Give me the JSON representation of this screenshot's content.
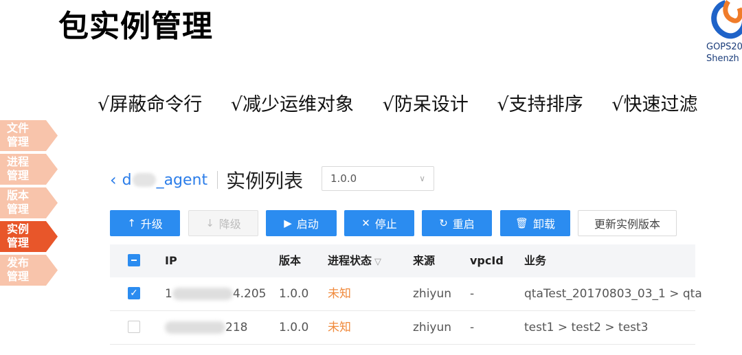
{
  "slide": {
    "title": "包实例管理",
    "logo": {
      "line1": "GOPS20",
      "line2": "Shenzh"
    },
    "features": [
      "√屏蔽命令行",
      "√减少运维对象",
      "√防呆设计",
      "√支持排序",
      "√快速过滤"
    ]
  },
  "nav": {
    "items": [
      {
        "line1": "文件",
        "line2": "管理",
        "active": false
      },
      {
        "line1": "进程",
        "line2": "管理",
        "active": false
      },
      {
        "line1": "版本",
        "line2": "管理",
        "active": false
      },
      {
        "line1": "实例",
        "line2": "管理",
        "active": true
      },
      {
        "line1": "发布",
        "line2": "管理",
        "active": false
      }
    ]
  },
  "header": {
    "back_icon": "chevron-left-icon",
    "agent_prefix": "d",
    "agent_suffix": "_agent",
    "list_title": "实例列表",
    "version_select": {
      "value": "1.0.0"
    }
  },
  "toolbar": {
    "upgrade": {
      "label": "升级",
      "icon": "upload-icon"
    },
    "downgrade": {
      "label": "降级",
      "icon": "download-icon",
      "disabled": true
    },
    "start": {
      "label": "启动",
      "icon": "play-icon"
    },
    "stop": {
      "label": "停止",
      "icon": "close-icon"
    },
    "restart": {
      "label": "重启",
      "icon": "refresh-icon"
    },
    "uninstall": {
      "label": "卸载",
      "icon": "trash-icon"
    },
    "update_version": {
      "label": "更新实例版本"
    }
  },
  "table": {
    "columns": {
      "ip": "IP",
      "version": "版本",
      "status": "进程状态",
      "source": "来源",
      "vpcid": "vpcId",
      "business": "业务"
    },
    "rows": [
      {
        "checked": true,
        "ip_prefix": "1",
        "ip_suffix": "4.205",
        "version": "1.0.0",
        "status": "未知",
        "source": "zhiyun",
        "vpcid": "-",
        "business": "qtaTest_20170803_03_1 > qta"
      },
      {
        "checked": false,
        "ip_prefix": "",
        "ip_suffix": "218",
        "version": "1.0.0",
        "status": "未知",
        "source": "zhiyun",
        "vpcid": "-",
        "business": "test1 > test2 > test3"
      }
    ]
  },
  "colors": {
    "primary": "#2b8cf0",
    "nav_active": "#e8562a",
    "nav_inactive": "#f8c4ab",
    "status_unknown": "#f08a3c"
  }
}
